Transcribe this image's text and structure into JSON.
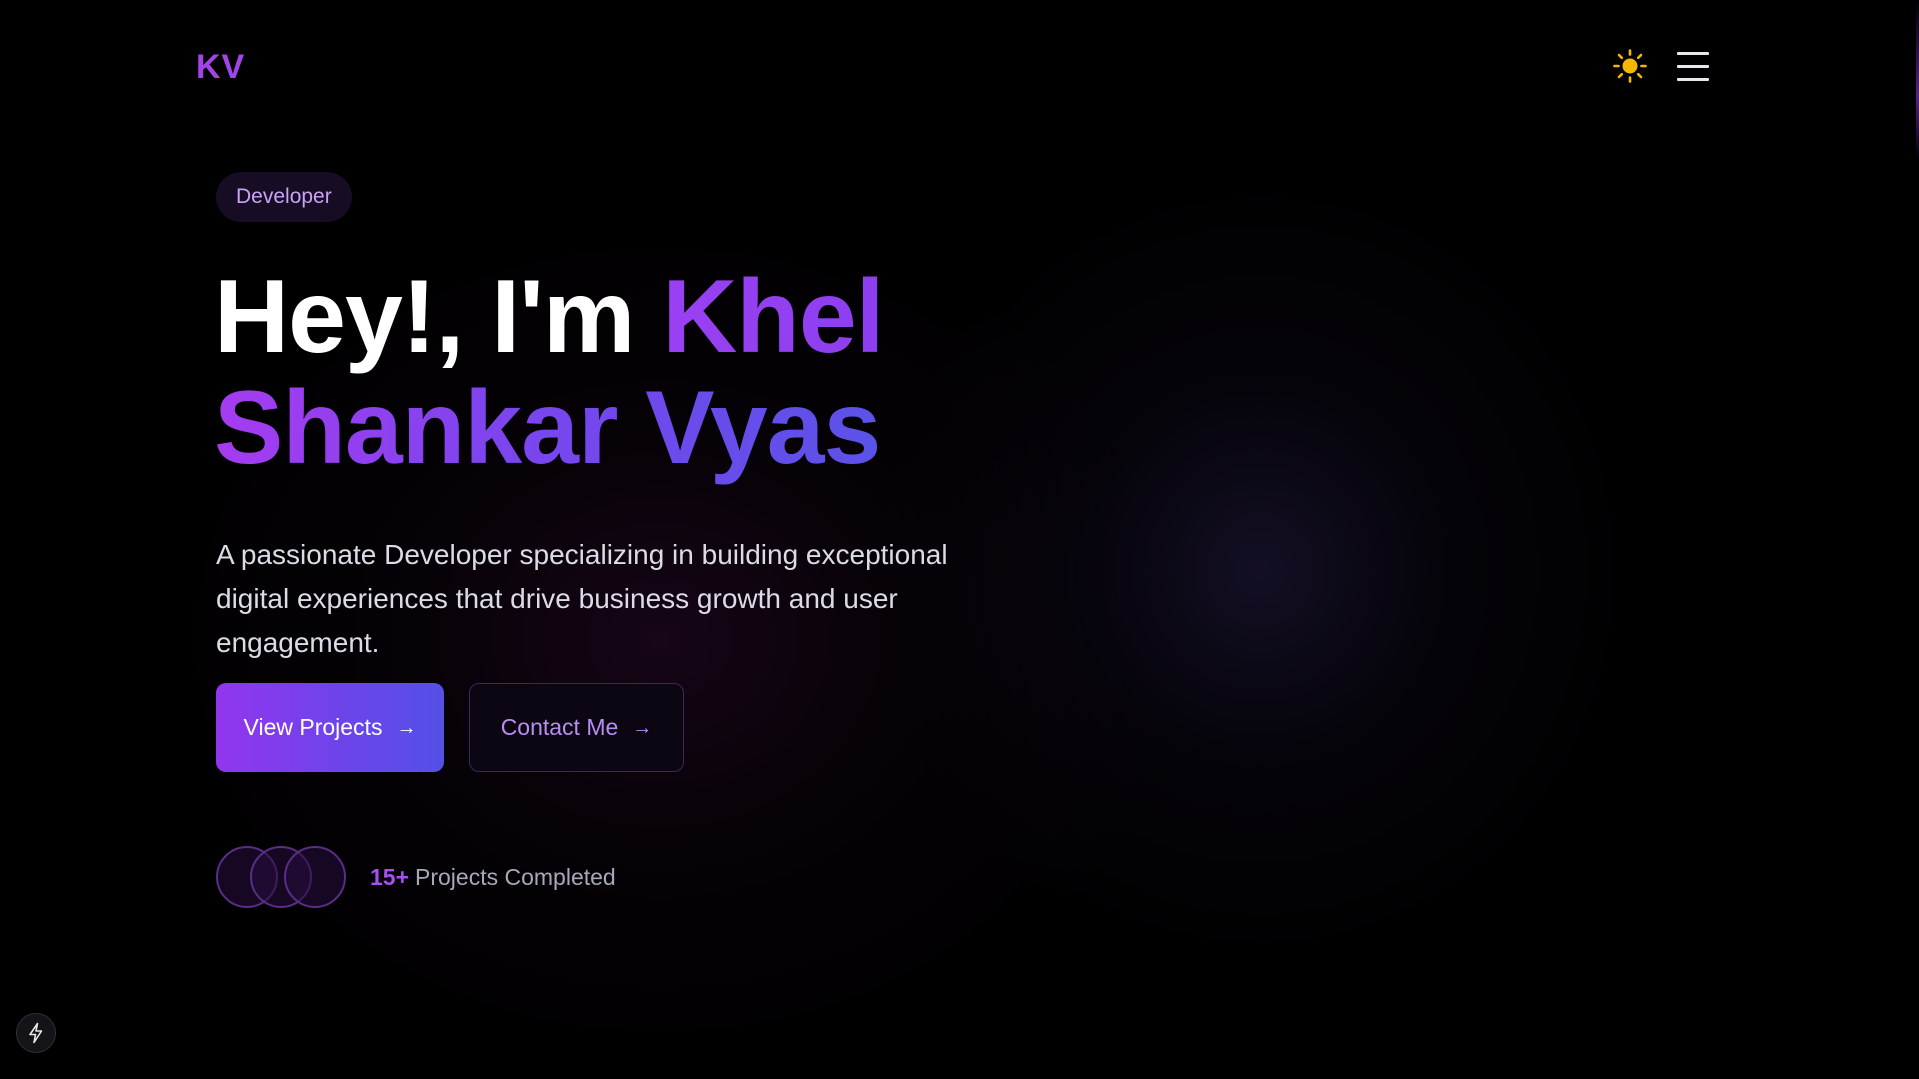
{
  "header": {
    "logo": "KV",
    "theme_icon": "sun-icon",
    "menu_icon": "hamburger-menu-icon"
  },
  "hero": {
    "badge": "Developer",
    "headline_intro": "Hey!, I'm ",
    "headline_name_part1": "Khel",
    "headline_name_part2": "Shankar Vyas",
    "description": "A passionate Developer specializing in building exceptional digital experiences that drive business growth and user engagement."
  },
  "buttons": {
    "primary_label": "View Projects",
    "secondary_label": "Contact Me",
    "arrow_glyph": "→",
    "arrow_icon": "arrow-right-icon"
  },
  "stats": {
    "value": "15+",
    "label": "Projects Completed"
  },
  "devtools": {
    "icon": "lightning-bolt-icon"
  },
  "colors": {
    "background": "#000000",
    "accent_purple": "#a244ea",
    "accent_indigo": "#5550e6",
    "sun": "#f5b800"
  }
}
